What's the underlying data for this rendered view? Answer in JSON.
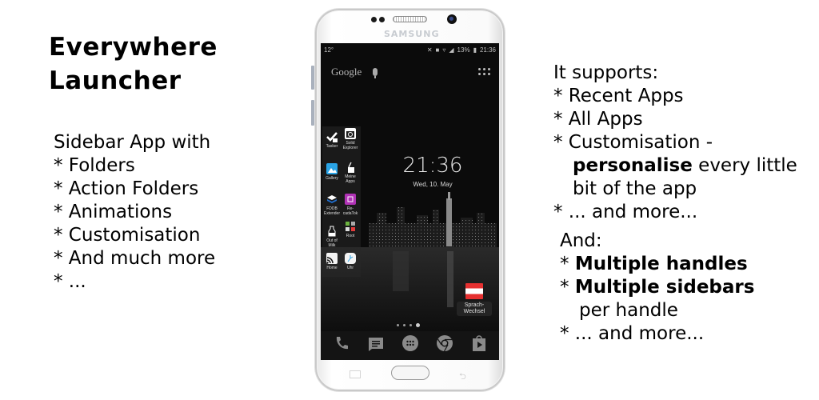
{
  "title": {
    "line1": "Everywhere",
    "line2": "Launcher"
  },
  "left_features": {
    "intro": "Sidebar App with",
    "items": [
      "* Folders",
      "* Action Folders",
      "* Animations",
      "* Customisation",
      "* And much more",
      "* ..."
    ]
  },
  "right_features": {
    "intro": "It supports:",
    "item1": "* Recent Apps",
    "item2": "* All Apps",
    "item3": "* Customisation -",
    "item3_bold": "personalise",
    "item3_rest": " every little",
    "item3_line3": "bit of the app",
    "item4": "* ... and more..."
  },
  "and_features": {
    "intro": "And:",
    "item1_prefix": "* ",
    "item1_bold": "Multiple handles",
    "item2_prefix": "* ",
    "item2_bold": "Multiple sidebars",
    "item2_cont": "per handle",
    "item3": "* ... and more..."
  },
  "phone": {
    "brand": "SAMSUNG",
    "status": {
      "temperature": "12°",
      "battery": "13%",
      "time": "21:36"
    },
    "search": {
      "label": "Google"
    },
    "clock": {
      "time": "21:36",
      "date": "Wed, 10. May"
    },
    "sidebar_items": [
      {
        "label": "Tasker",
        "icon": "tasker-icon"
      },
      {
        "label": "Solid Explorer",
        "icon": "solid-explorer-icon"
      },
      {
        "label": "Gallery",
        "icon": "gallery-icon"
      },
      {
        "label": "Meine Apps",
        "icon": "meine-apps-icon"
      },
      {
        "label": "FDDB Extender",
        "icon": "fddb-icon"
      },
      {
        "label": "Re-cadaTok",
        "icon": "recadatok-icon"
      },
      {
        "label": "Out of Milk",
        "icon": "milk-icon"
      },
      {
        "label": "Root",
        "icon": "folder-icon"
      },
      {
        "label": "Home",
        "icon": "cast-icon"
      },
      {
        "label": "Uhr",
        "icon": "clock-icon"
      }
    ],
    "desktop_shortcut": {
      "label": "Sprach-Wechsel",
      "line1": "Sprach-",
      "line2": "Wechsel"
    },
    "page_indicator": {
      "pages": 4,
      "active": 4
    },
    "dock": [
      "phone-icon",
      "messages-icon",
      "app-drawer-icon",
      "chrome-icon",
      "play-store-icon"
    ]
  },
  "colors": {
    "flag_red": "#e53030",
    "screen_bg": "#0c0c0c"
  }
}
